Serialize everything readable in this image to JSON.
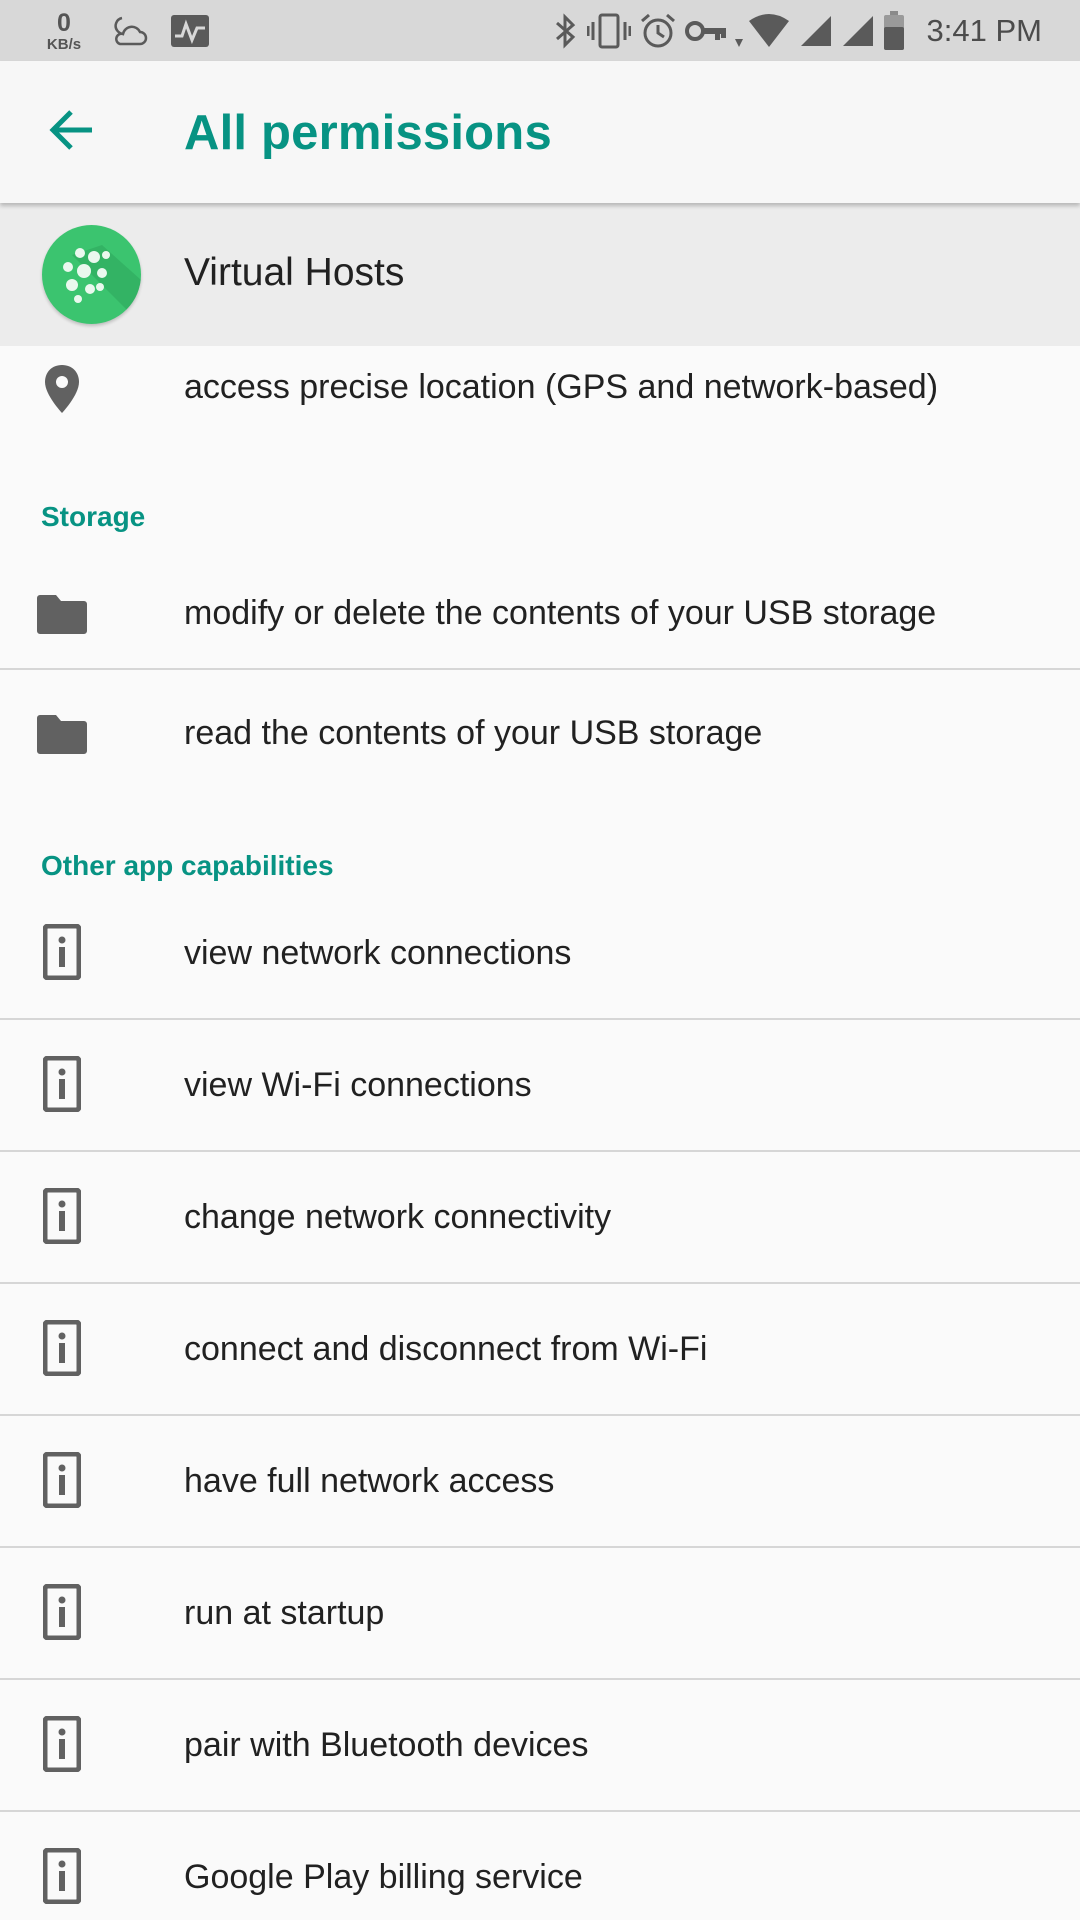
{
  "status_bar": {
    "net_speed_value": "0",
    "net_speed_unit": "KB/s",
    "time": "3:41 PM",
    "icons": [
      "weather-cloudy-night-icon",
      "activity-monitor-icon",
      "bluetooth-icon",
      "vibrate-icon",
      "alarm-icon",
      "vpn-key-icon",
      "wifi-icon",
      "signal-icon",
      "signal-icon",
      "battery-icon"
    ]
  },
  "app_bar": {
    "title": "All permissions",
    "back_icon": "arrow-back-icon"
  },
  "app": {
    "name": "Virtual Hosts",
    "icon": "app-icon"
  },
  "location": {
    "items": [
      {
        "label": "access precise location (GPS and network-based)",
        "icon": "location-pin-icon"
      }
    ]
  },
  "storage": {
    "header": "Storage",
    "items": [
      {
        "label": "modify or delete the contents of your USB storage",
        "icon": "folder-icon"
      },
      {
        "label": "read the contents of your USB storage",
        "icon": "folder-icon"
      }
    ]
  },
  "other": {
    "header": "Other app capabilities",
    "items": [
      {
        "label": "view network connections",
        "icon": "device-info-icon"
      },
      {
        "label": "view Wi-Fi connections",
        "icon": "device-info-icon"
      },
      {
        "label": "change network connectivity",
        "icon": "device-info-icon"
      },
      {
        "label": "connect and disconnect from Wi-Fi",
        "icon": "device-info-icon"
      },
      {
        "label": "have full network access",
        "icon": "device-info-icon"
      },
      {
        "label": "run at startup",
        "icon": "device-info-icon"
      },
      {
        "label": "pair with Bluetooth devices",
        "icon": "device-info-icon"
      },
      {
        "label": "Google Play billing service",
        "icon": "device-info-icon"
      }
    ]
  },
  "colors": {
    "accent": "#079383",
    "status_bar": "#d8d8d8",
    "app_bar": "#f7f7f7",
    "header_row": "#ececec",
    "app_icon": "#3bc46f",
    "icon_gray": "#616161"
  }
}
